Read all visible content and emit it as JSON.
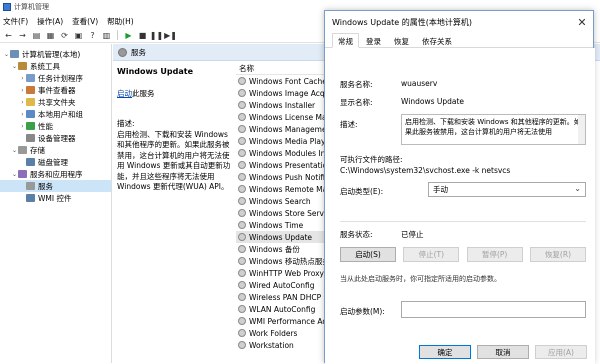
{
  "window": {
    "title": "计算机管理",
    "menu": [
      "文件(F)",
      "操作(A)",
      "查看(V)",
      "帮助(H)"
    ]
  },
  "tree": [
    {
      "label": "计算机管理(本地)",
      "indent": 0,
      "arrow": "v",
      "icon": "comp"
    },
    {
      "label": "系统工具",
      "indent": 1,
      "arrow": "v",
      "icon": "tool"
    },
    {
      "label": "任务计划程序",
      "indent": 2,
      "arrow": ">",
      "icon": "task"
    },
    {
      "label": "事件查看器",
      "indent": 2,
      "arrow": ">",
      "icon": "event"
    },
    {
      "label": "共享文件夹",
      "indent": 2,
      "arrow": ">",
      "icon": "share"
    },
    {
      "label": "本地用户和组",
      "indent": 2,
      "arrow": ">",
      "icon": "user"
    },
    {
      "label": "性能",
      "indent": 2,
      "arrow": ">",
      "icon": "perf"
    },
    {
      "label": "设备管理器",
      "indent": 2,
      "arrow": "",
      "icon": "dev"
    },
    {
      "label": "存储",
      "indent": 1,
      "arrow": "v",
      "icon": "store"
    },
    {
      "label": "磁盘管理",
      "indent": 2,
      "arrow": "",
      "icon": "disk"
    },
    {
      "label": "服务和应用程序",
      "indent": 1,
      "arrow": "v",
      "icon": "svcapp"
    },
    {
      "label": "服务",
      "indent": 2,
      "arrow": "",
      "icon": "gear",
      "selected": true
    },
    {
      "label": "WMI 控件",
      "indent": 2,
      "arrow": "",
      "icon": "wmi"
    }
  ],
  "services_header": "服务",
  "desc_pane": {
    "service_name": "Windows Update",
    "start_link": "启动",
    "start_suffix": "此服务",
    "desc_label": "描述:",
    "desc_text": "启用检测、下载和安装 Windows 和其他程序的更新。如果此服务被禁用，这台计算机的用户将无法使用 Windows 更新或其自动更新功能，并且这些程序将无法使用 Windows 更新代理(WUA) API。"
  },
  "list": {
    "column": "名称",
    "rows": [
      "Windows Font Cache Service",
      "Windows Image Acquisition",
      "Windows Installer",
      "Windows License Manager",
      "Windows Management",
      "Windows Media Player",
      "Windows Modules Installer",
      "Windows Presentation",
      "Windows Push Notification",
      "Windows Remote Management",
      "Windows Search",
      "Windows Store Service",
      "Windows Time",
      "Windows Update",
      "Windows 备份",
      "Windows 移动热点服务",
      "WinHTTP Web Proxy",
      "Wired AutoConfig",
      "Wireless PAN DHCP Server",
      "WLAN AutoConfig",
      "WMI Performance Adapter",
      "Work Folders",
      "Workstation"
    ],
    "selected_index": 13
  },
  "dialog": {
    "title": "Windows Update 的属性(本地计算机)",
    "tabs": [
      "常规",
      "登录",
      "恢复",
      "依存关系"
    ],
    "service_name_label": "服务名称:",
    "service_name": "wuauserv",
    "display_name_label": "显示名称:",
    "display_name": "Windows Update",
    "description_label": "描述:",
    "description": "启用检测、下载和安装 Windows 和其他程序的更新。如果此服务被禁用，这台计算机的用户将无法使用",
    "path_label": "可执行文件的路径:",
    "path": "C:\\Windows\\system32\\svchost.exe -k netsvcs",
    "startup_label": "启动类型(E):",
    "startup_value": "手动",
    "status_label": "服务状态:",
    "status_value": "已停止",
    "buttons": {
      "start": "启动(S)",
      "stop": "停止(T)",
      "pause": "暂停(P)",
      "resume": "恢复(R)"
    },
    "hint": "当从此处启动服务时，你可指定所适用的启动参数。",
    "param_label": "启动参数(M):",
    "footer": {
      "ok": "确定",
      "cancel": "取消",
      "apply": "应用(A)"
    }
  }
}
